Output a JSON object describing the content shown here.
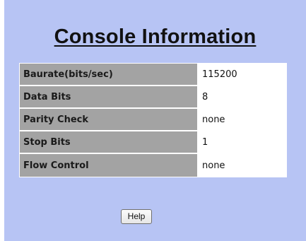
{
  "page": {
    "title": "Console Information"
  },
  "console_info": {
    "rows": [
      {
        "label": "Baurate(bits/sec)",
        "value": "115200"
      },
      {
        "label": "Data Bits",
        "value": "8"
      },
      {
        "label": "Parity Check",
        "value": "none"
      },
      {
        "label": "Stop Bits",
        "value": "1"
      },
      {
        "label": "Flow Control",
        "value": "none"
      }
    ]
  },
  "actions": {
    "help_label": "Help"
  },
  "colors": {
    "panel_background": "#b7c4f4",
    "label_cell": "#a3a3a3",
    "value_cell": "#ffffff"
  }
}
